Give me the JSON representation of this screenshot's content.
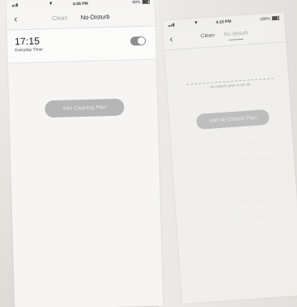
{
  "left_screen": {
    "status_bar": {
      "time": "4:08 PM",
      "right_status": "99%"
    },
    "nav": {
      "back_icon": "chevron-left-icon",
      "tabs": [
        {
          "label": "Clean",
          "active": false
        },
        {
          "label": "No-Disturb",
          "active": true
        }
      ]
    },
    "schedule": {
      "time": "17:15",
      "repeat": "Everyday Timer",
      "toggle_on": true
    },
    "add_button": "Add Cleaning Plan"
  },
  "right_screen": {
    "status_bar": {
      "time": "4:10 PM",
      "right_status": "100%"
    },
    "nav": {
      "back_icon": "chevron-left-icon",
      "tabs": [
        {
          "label": "Clean",
          "active": false
        },
        {
          "label": "No-disturb",
          "active": true
        }
      ]
    },
    "empty_note": "No-disturb plan is not set",
    "add_button": "Add No-Disturb Plan"
  },
  "colors": {
    "button_bg": "#b6b6b6",
    "toggle_bg": "#8e8e8e",
    "panel_bg": "#f6f5f3",
    "page_bg": "#e9e7e3"
  }
}
